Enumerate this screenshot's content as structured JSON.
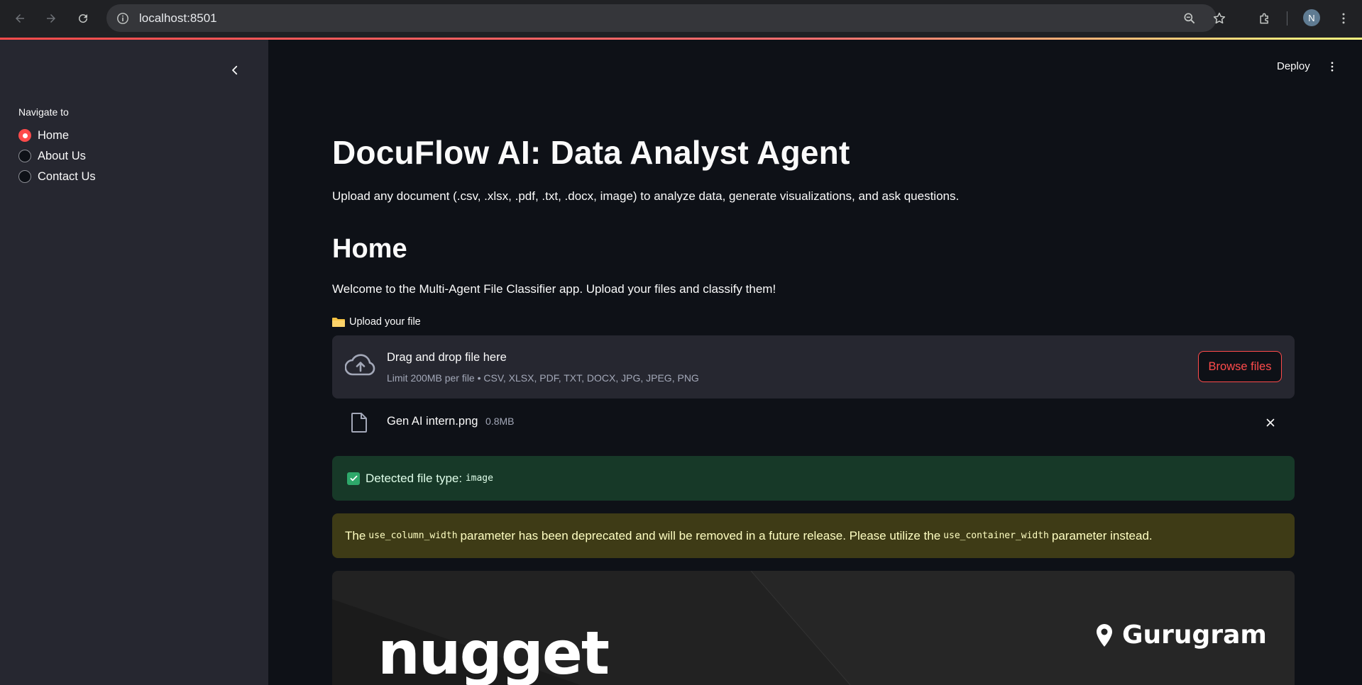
{
  "browser": {
    "url": "localhost:8501",
    "profile_initial": "N",
    "icons": [
      "back-arrow-icon",
      "forward-arrow-icon",
      "reload-icon",
      "site-info-icon",
      "zoom-icon",
      "bookmark-star-icon",
      "extensions-icon",
      "browser-menu-icon"
    ]
  },
  "sidebar": {
    "nav_label": "Navigate to",
    "items": [
      {
        "label": "Home",
        "selected": true
      },
      {
        "label": "About Us",
        "selected": false
      },
      {
        "label": "Contact Us",
        "selected": false
      }
    ]
  },
  "toolbar": {
    "deploy_label": "Deploy"
  },
  "main": {
    "title": "DocuFlow AI: Data Analyst Agent",
    "subtitle": "Upload any document (.csv, .xlsx, .pdf, .txt, .docx, image) to analyze data, generate visualizations, and ask questions.",
    "section_title": "Home",
    "welcome": "Welcome to the Multi-Agent File Classifier app. Upload your files and classify them!",
    "upload_label": "Upload your file",
    "dropzone": {
      "title": "Drag and drop file here",
      "limit": "Limit 200MB per file • CSV, XLSX, PDF, TXT, DOCX, JPG, JPEG, PNG",
      "browse_label": "Browse files"
    },
    "uploaded_file": {
      "name": "Gen AI intern.png",
      "size": "0.8MB"
    },
    "success": {
      "text": "Detected file type:",
      "code": "image"
    },
    "warning": {
      "part1": "The",
      "code1": "use_column_width",
      "part2": "parameter has been deprecated and will be removed in a future release. Please utilize the",
      "code2": "use_container_width",
      "part3": "parameter instead."
    },
    "image_preview": {
      "brand": "nugget",
      "location": "Gurugram"
    }
  },
  "colors": {
    "accent": "#ff4b4b",
    "sidebar_bg": "#262730",
    "main_bg": "#0e1117",
    "success_bg": "#173928",
    "warning_bg": "#3e3b16"
  }
}
